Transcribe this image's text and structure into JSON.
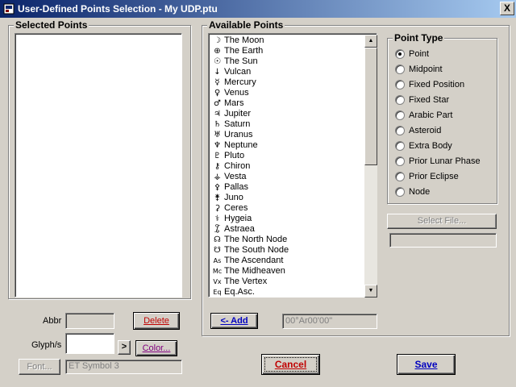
{
  "window": {
    "title": "User-Defined Points Selection - My UDP.ptu",
    "close_label": "X"
  },
  "selected_points": {
    "label": "Selected Points"
  },
  "available_points": {
    "label": "Available Points",
    "items": [
      {
        "glyph": "☽",
        "label": "The Moon"
      },
      {
        "glyph": "⊕",
        "label": "The Earth"
      },
      {
        "glyph": "☉",
        "label": "The Sun"
      },
      {
        "glyph": "↓",
        "label": "Vulcan"
      },
      {
        "glyph": "☿",
        "label": "Mercury"
      },
      {
        "glyph": "♀",
        "label": "Venus"
      },
      {
        "glyph": "♂",
        "label": "Mars"
      },
      {
        "glyph": "♃",
        "label": "Jupiter"
      },
      {
        "glyph": "♄",
        "label": "Saturn"
      },
      {
        "glyph": "♅",
        "label": "Uranus"
      },
      {
        "glyph": "♆",
        "label": "Neptune"
      },
      {
        "glyph": "♇",
        "label": "Pluto"
      },
      {
        "glyph": "⚷",
        "label": "Chiron"
      },
      {
        "glyph": "⚶",
        "label": "Vesta"
      },
      {
        "glyph": "⚴",
        "label": "Pallas"
      },
      {
        "glyph": "⚵",
        "label": "Juno"
      },
      {
        "glyph": "⚳",
        "label": "Ceres"
      },
      {
        "glyph": "⚕",
        "label": "Hygeia"
      },
      {
        "glyph": "⯙",
        "label": "Astraea"
      },
      {
        "glyph": "☊",
        "label": "The North Node"
      },
      {
        "glyph": "☋",
        "label": "The South Node"
      },
      {
        "glyph": "As",
        "label": "The Ascendant"
      },
      {
        "glyph": "Mc",
        "label": "The Midheaven"
      },
      {
        "glyph": "Vx",
        "label": "The Vertex"
      },
      {
        "glyph": "Eq",
        "label": "Eq.Asc."
      }
    ]
  },
  "point_type": {
    "label": "Point Type",
    "options": [
      "Point",
      "Midpoint",
      "Fixed Position",
      "Fixed Star",
      "Arabic Part",
      "Asteroid",
      "Extra Body",
      "Prior Lunar Phase",
      "Prior Eclipse",
      "Node"
    ],
    "selected": "Point"
  },
  "select_file": {
    "label": "Select File...",
    "path_value": ""
  },
  "abbr": {
    "label": "Abbr",
    "value": ""
  },
  "glyphs": {
    "label": "Glyph/s",
    "value": "",
    "arrow_label": ">"
  },
  "font": {
    "button_label": "Font...",
    "value": "ET Symbol 3"
  },
  "buttons": {
    "delete": "Delete",
    "color": "Color...",
    "add": "<- Add",
    "cancel": "Cancel",
    "save": "Save"
  },
  "position_value": "00°Ar00'00\""
}
